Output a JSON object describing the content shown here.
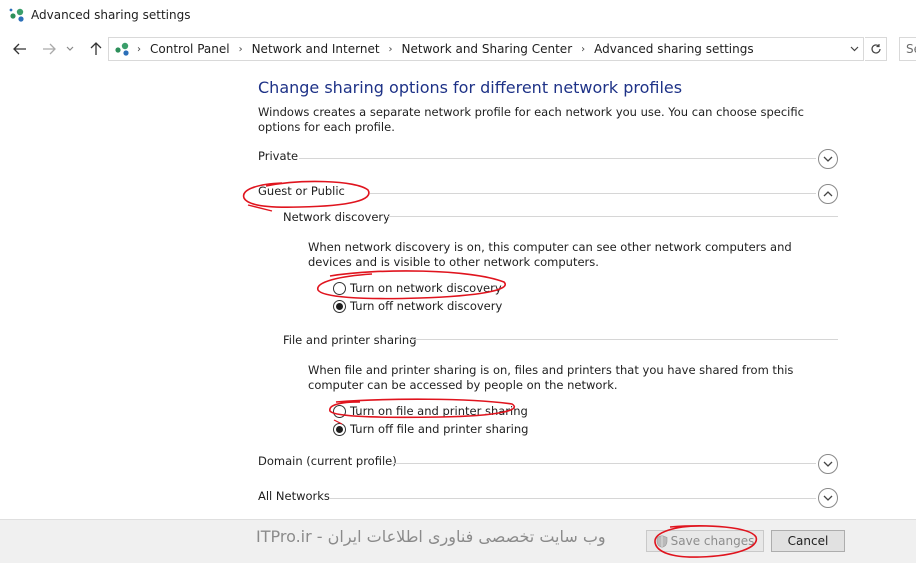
{
  "window": {
    "title": "Advanced sharing settings",
    "icon": "network-sharing-icon"
  },
  "nav": {
    "back": "back-arrow-icon",
    "forward": "forward-arrow-icon",
    "recent": "chevron-down-icon",
    "up": "up-arrow-icon",
    "breadcrumbs": [
      "Control Panel",
      "Network and Internet",
      "Network and Sharing Center",
      "Advanced sharing settings"
    ],
    "search_placeholder": "Se"
  },
  "main": {
    "heading": "Change sharing options for different network profiles",
    "intro": "Windows creates a separate network profile for each network you use. You can choose specific options for each profile.",
    "profiles": {
      "private": "Private",
      "guest": "Guest or Public",
      "domain": "Domain (current profile)",
      "all": "All Networks"
    },
    "network_discovery": {
      "title": "Network discovery",
      "description": "When network discovery is on, this computer can see other network computers and devices and is visible to other network computers.",
      "on_label": "Turn on network discovery",
      "off_label": "Turn off network discovery",
      "selected": "off"
    },
    "file_sharing": {
      "title": "File and printer sharing",
      "description": "When file and printer sharing is on, files and printers that you have shared from this computer can be accessed by people on the network.",
      "on_label": "Turn on file and printer sharing",
      "off_label": "Turn off file and printer sharing",
      "selected": "off"
    }
  },
  "footer": {
    "watermark": "ITPro.ir - وب سایت تخصصی فناوری اطلاعات ایران",
    "save_label": "Save changes",
    "cancel_label": "Cancel"
  },
  "colors": {
    "heading": "#1e3287",
    "annotation": "#e0141e",
    "footer_bg": "#f0f0f0"
  }
}
